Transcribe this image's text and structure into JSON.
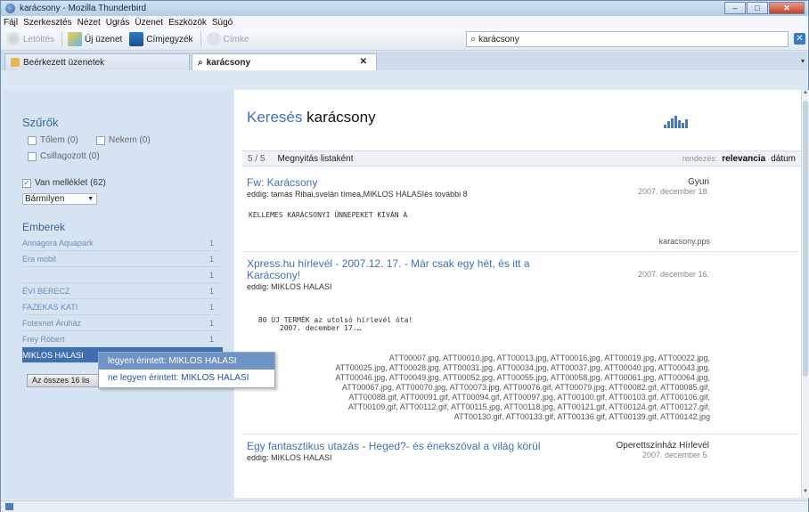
{
  "window": {
    "title": "karácsony - Mozilla Thunderbird",
    "controls": [
      "‒",
      "□",
      "✕"
    ]
  },
  "menu": [
    "Fájl",
    "Szerkesztés",
    "Nézet",
    "Ugrás",
    "Üzenet",
    "Eszközök",
    "Súgó"
  ],
  "toolbar": {
    "get_label": "Letöltés",
    "write_label": "Új üzenet",
    "addressbook_label": "Címjegyzék",
    "tag_label": "Címke"
  },
  "search": {
    "value": "karácsony"
  },
  "tabs": [
    {
      "label": "Beérkezett üzenetek"
    },
    {
      "label": "karácsony"
    }
  ],
  "filters": {
    "heading": "Szűrők",
    "from_me": "Tőlem (0)",
    "to_me": "Nekem (0)",
    "starred": "Csillagozott (0)",
    "has_attachment": "Van melléklet (62)",
    "attachment_type": "Bármilyen"
  },
  "people": {
    "heading": "Emberek",
    "list": [
      {
        "name": "Annagora Aquapark",
        "count": "1"
      },
      {
        "name": "Era mobil",
        "count": "1"
      },
      {
        "name": "",
        "count": "1"
      },
      {
        "name": "ÉVI BERECZ",
        "count": "1"
      },
      {
        "name": "FAZEKAS KATI",
        "count": "1"
      },
      {
        "name": "Fotexnet Áruház",
        "count": "1"
      },
      {
        "name": "Frey Róbert",
        "count": "1"
      },
      {
        "name": "MIKLOS HALASI",
        "count": ""
      }
    ],
    "all_button": "Az összes 16 lis"
  },
  "popup": {
    "item1": "legyen érintett: MIKLOS HALASI",
    "item2": "ne legyen érintett: MIKLOS HALASI"
  },
  "main": {
    "title_prefix": "Keresés",
    "title_term": "karácsony",
    "count": "5 / 5",
    "open_as_list": "Megnyitás listaként",
    "sort_label": "rendezés:",
    "sort_relevance": "relevancia",
    "sort_date": "dátum"
  },
  "results": [
    {
      "subject": "Fw: Karácsony",
      "from": "eddig: tamás Ribai,svelán tímea,MIKLOS HALASIés további 8",
      "sender": "Gyuri",
      "date": "2007. december 18.",
      "snippet": "KELLEMES KARÁCSONYI ÜNNEPEKET KÍVÁN A",
      "attachment": "karacsony.pps"
    },
    {
      "subject": "Xpress.hu hírlevél - 2007.12. 17. - Már csak egy hét, és itt a",
      "subject2": "Karácsony!",
      "from": "eddig: MIKLOS HALASI",
      "date": "2007. december 16.",
      "snippet": " 80 ÚJ TERMÉK az utolsó hírlevél óta!\n      2007. december 17.…",
      "attachments": [
        "ATT00007.jpg, ATT00010.jpg, ATT00013.jpg, ATT00016.jpg, ATT00019.jpg, ATT00022.jpg,",
        "ATT00025.jpg, ATT00028.jpg, ATT00031.jpg, ATT00034.jpg, ATT00037.jpg, ATT00040.jpg, ATT00043.jpg,",
        "ATT00046.jpg, ATT00049.jpg, ATT00052.jpg, ATT00055.jpg, ATT00058.jpg, ATT00061.jpg, ATT00064.jpg,",
        "ATT00067.jpg, ATT00070.jpg, ATT00073.jpg, ATT00076.gif, ATT00079.jpg, ATT00082.gif, ATT00085.gif,",
        "ATT00088.gif, ATT00091.gif, ATT00094.gif, ATT00097.jpg, ATT00100.gif, ATT00103.gif, ATT00106.gif,",
        "ATT00109.gif, ATT00112.gif, ATT00115.jpg, ATT00118.jpg, ATT00121.gif, ATT00124.gif, ATT00127.gif,",
        "ATT00130.gif, ATT00133.gif, ATT00136.gif, ATT00139.gif, ATT00142.jpg"
      ]
    },
    {
      "subject": "Egy fantasztikus utazás - Heged?- és énekszóval a világ körül",
      "from": "eddig: MIKLOS HALASI",
      "sender": "Operettszínház Hírlevél",
      "date": "2007. december 5."
    }
  ],
  "colors": {
    "accent": "#4271b2",
    "selected": "#3e6fae",
    "pane": "#d6e3f2"
  }
}
